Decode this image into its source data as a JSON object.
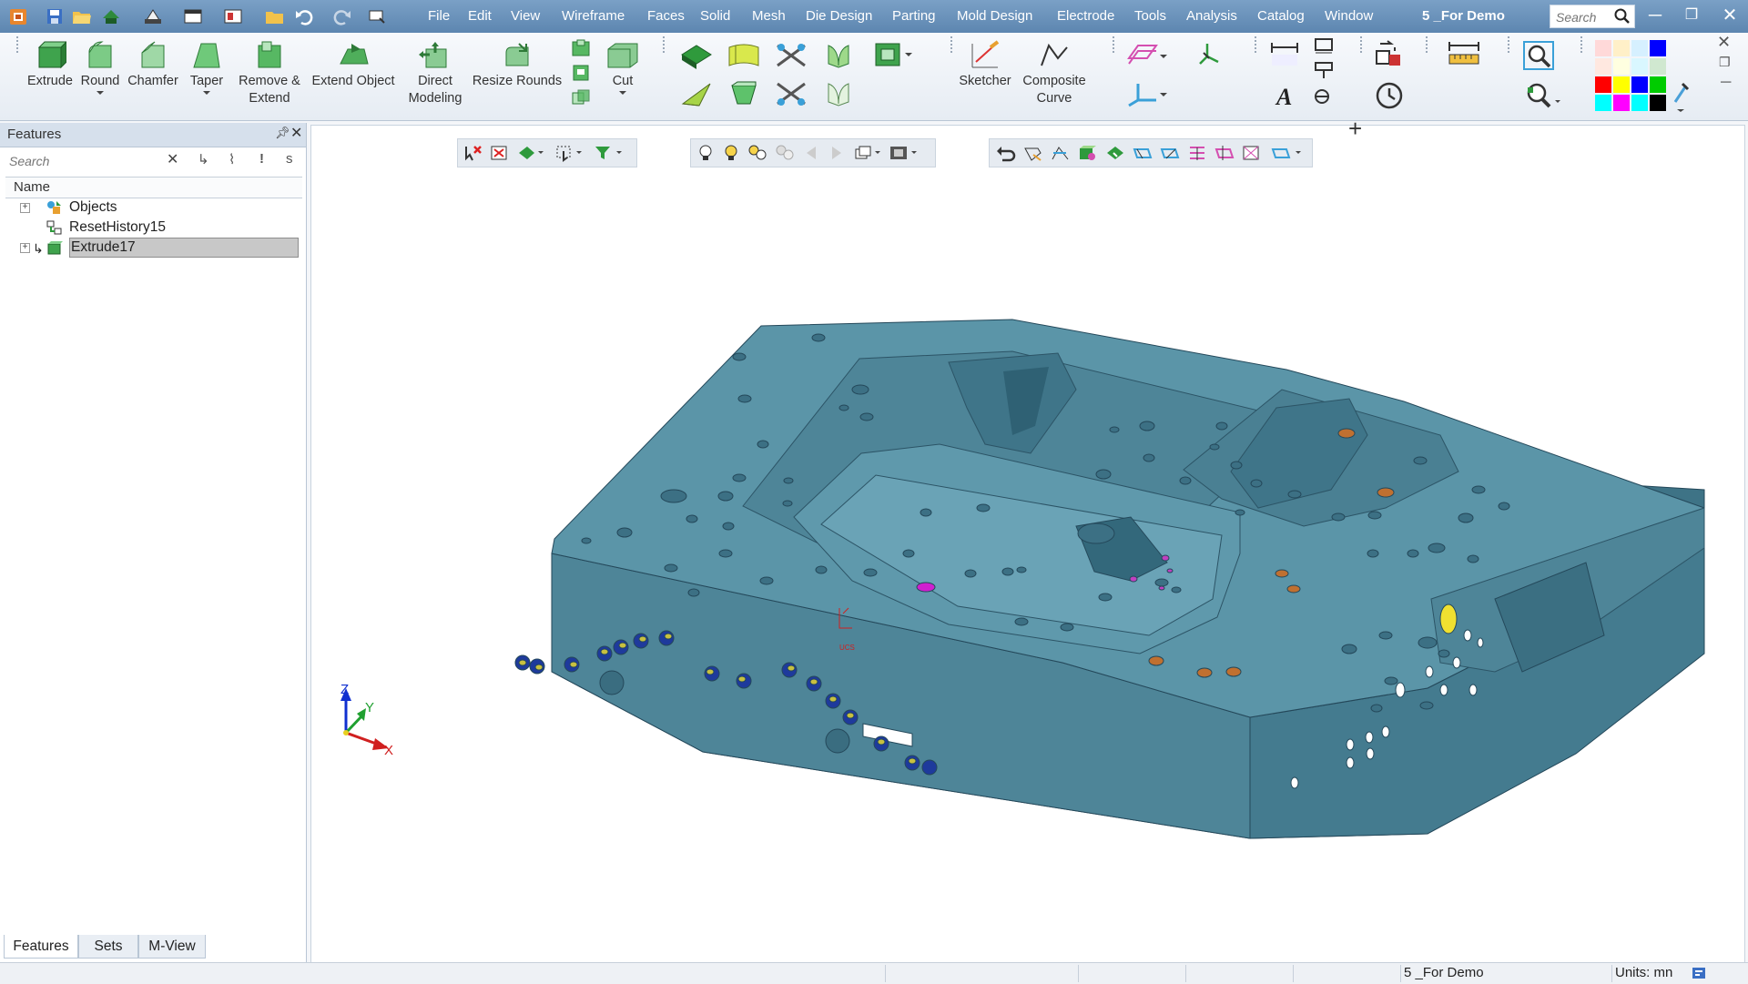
{
  "app": {
    "window_title": "5 _For Demo"
  },
  "menu": [
    "File",
    "Edit",
    "View",
    "Wireframe",
    "Faces",
    "Solid",
    "Mesh",
    "Die Design",
    "Parting",
    "Mold Design",
    "Electrode",
    "Tools",
    "Analysis",
    "Catalog",
    "Window"
  ],
  "global_search": {
    "placeholder": "Search"
  },
  "ribbon": {
    "extrude": "Extrude",
    "round": "Round",
    "chamfer": "Chamfer",
    "taper": "Taper",
    "remove_extend_1": "Remove &",
    "remove_extend_2": "Extend",
    "extend_object": "Extend Object",
    "direct_modeling_1": "Direct",
    "direct_modeling_2": "Modeling",
    "resize_rounds": "Resize Rounds",
    "cut": "Cut",
    "sketcher": "Sketcher",
    "composite_curve_1": "Composite",
    "composite_curve_2": "Curve"
  },
  "palette_colors": [
    "#ffd9d9",
    "#fff0c8",
    "#d6f0ff",
    "#0000ff",
    "#ffe8e0",
    "#ffffe0",
    "#d9f7ff",
    "#d0e8d0",
    "#ff0000",
    "#ffff00",
    "#0000ff",
    "#00cc00",
    "#00ffff",
    "#ff00ff",
    "#00ffff",
    "#000000"
  ],
  "features_panel": {
    "title": "Features",
    "search_placeholder": "Search",
    "column_header": "Name",
    "tree": [
      {
        "label": "Objects",
        "expandable": true
      },
      {
        "label": "ResetHistory15",
        "expandable": false
      },
      {
        "label": "Extrude17",
        "expandable": true,
        "selected": true
      }
    ],
    "tabs": [
      "Features",
      "Sets",
      "M-View"
    ]
  },
  "viewport": {
    "triad": {
      "x": "X",
      "y": "Y",
      "z": "Z"
    },
    "model_color": "#4f8497"
  },
  "statusbar": {
    "document": "5 _For Demo",
    "units": "Units: mn"
  }
}
